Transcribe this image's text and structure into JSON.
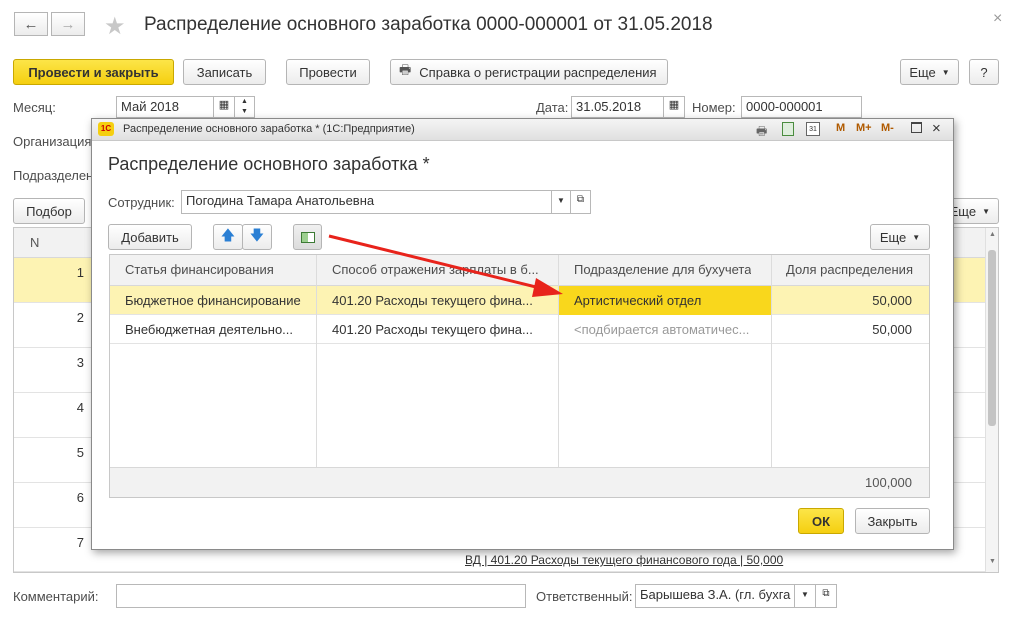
{
  "window": {
    "title": "Распределение основного заработка 0000-000001 от 31.05.2018",
    "close": "×"
  },
  "toolbar": {
    "post_close": "Провести и закрыть",
    "save": "Записать",
    "post": "Провести",
    "report": "Справка о регистрации распределения",
    "more": "Еще",
    "help": "?"
  },
  "form": {
    "month_label": "Месяц:",
    "month_value": "Май 2018",
    "date_label": "Дата:",
    "date_value": "31.05.2018",
    "number_label": "Номер:",
    "number_value": "0000-000001",
    "org_label": "Организация",
    "dept_label": "Подразделен",
    "pick_button": "Подбор",
    "more_right": "Еще",
    "col_n": "N",
    "rows": [
      "1",
      "2",
      "3",
      "4",
      "5",
      "6",
      "7"
    ],
    "footer_link": "ВД | 401.20 Расходы текущего финансового года | 50,000",
    "comment_label": "Комментарий:",
    "comment_value": "",
    "responsible_label": "Ответственный:",
    "responsible_value": "Барышева З.А. (гл. бухга"
  },
  "dialog": {
    "window_title": "Распределение основного заработка * (1С:Предприятие)",
    "heading": "Распределение основного заработка *",
    "employee_label": "Сотрудник:",
    "employee_value": "Погодина Тамара Анатольевна",
    "add_button": "Добавить",
    "more_button": "Еще",
    "title_letters": [
      "M",
      "M+",
      "M-"
    ],
    "columns": [
      "Статья финансирования",
      "Способ отражения зарплаты в б...",
      "Подразделение для бухучета",
      "Доля распределения"
    ],
    "rows": [
      {
        "article": "Бюджетное финансирование",
        "method": "401.20 Расходы текущего фина...",
        "dept": "Артистический отдел",
        "share": "50,000"
      },
      {
        "article": "Внебюджетная деятельно...",
        "method": "401.20 Расходы текущего фина...",
        "dept": "<подбирается автоматичес...",
        "share": "50,000"
      }
    ],
    "total": "100,000",
    "ok": "ОК",
    "close": "Закрыть"
  },
  "colors": {
    "accent_yellow": "#f5cf10",
    "selected_row": "#fdf3b3",
    "arrow_red": "#e8231b"
  }
}
